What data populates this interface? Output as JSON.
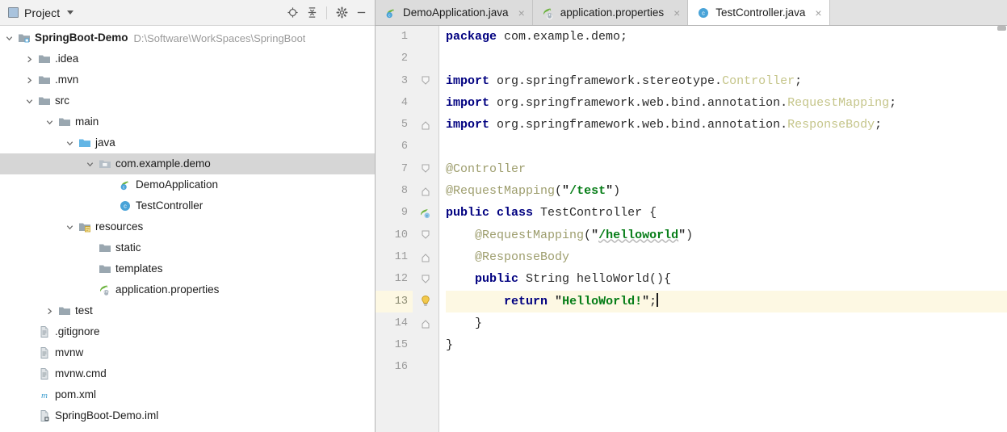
{
  "toolwindow": {
    "title": "Project",
    "dropdown_icon": "chevron-down-icon",
    "panel_icon": "project-view-icon",
    "actions": [
      {
        "name": "locate-icon",
        "label": "Select Opened File"
      },
      {
        "name": "collapse-all-icon",
        "label": "Collapse All"
      },
      {
        "name": "gear-icon",
        "label": "Settings"
      },
      {
        "name": "minimize-icon",
        "label": "Hide"
      }
    ]
  },
  "tree": [
    {
      "label": "SpringBoot-Demo",
      "path": "D:\\Software\\WorkSpaces\\SpringBoot",
      "indent": 0,
      "arrow": "expanded",
      "icon": "module-folder-icon",
      "bold": true,
      "selected": false
    },
    {
      "label": ".idea",
      "path": "",
      "indent": 1,
      "arrow": "collapsed",
      "icon": "folder-icon",
      "bold": false,
      "selected": false
    },
    {
      "label": ".mvn",
      "path": "",
      "indent": 1,
      "arrow": "collapsed",
      "icon": "folder-icon",
      "bold": false,
      "selected": false
    },
    {
      "label": "src",
      "path": "",
      "indent": 1,
      "arrow": "expanded",
      "icon": "folder-icon",
      "bold": false,
      "selected": false
    },
    {
      "label": "main",
      "path": "",
      "indent": 2,
      "arrow": "expanded",
      "icon": "folder-icon",
      "bold": false,
      "selected": false
    },
    {
      "label": "java",
      "path": "",
      "indent": 3,
      "arrow": "expanded",
      "icon": "source-folder-icon",
      "bold": false,
      "selected": false
    },
    {
      "label": "com.example.demo",
      "path": "",
      "indent": 4,
      "arrow": "expanded",
      "icon": "package-icon",
      "bold": false,
      "selected": true
    },
    {
      "label": "DemoApplication",
      "path": "",
      "indent": 5,
      "arrow": "none",
      "icon": "spring-boot-class-icon",
      "bold": false,
      "selected": false
    },
    {
      "label": "TestController",
      "path": "",
      "indent": 5,
      "arrow": "none",
      "icon": "java-class-icon",
      "bold": false,
      "selected": false
    },
    {
      "label": "resources",
      "path": "",
      "indent": 3,
      "arrow": "expanded",
      "icon": "resource-folder-icon",
      "bold": false,
      "selected": false
    },
    {
      "label": "static",
      "path": "",
      "indent": 4,
      "arrow": "none",
      "icon": "folder-icon",
      "bold": false,
      "selected": false
    },
    {
      "label": "templates",
      "path": "",
      "indent": 4,
      "arrow": "none",
      "icon": "folder-icon",
      "bold": false,
      "selected": false
    },
    {
      "label": "application.properties",
      "path": "",
      "indent": 4,
      "arrow": "none",
      "icon": "spring-properties-icon",
      "bold": false,
      "selected": false
    },
    {
      "label": "test",
      "path": "",
      "indent": 2,
      "arrow": "collapsed",
      "icon": "folder-icon",
      "bold": false,
      "selected": false
    },
    {
      "label": ".gitignore",
      "path": "",
      "indent": 1,
      "arrow": "none",
      "icon": "text-file-icon",
      "bold": false,
      "selected": false
    },
    {
      "label": "mvnw",
      "path": "",
      "indent": 1,
      "arrow": "none",
      "icon": "text-file-icon",
      "bold": false,
      "selected": false
    },
    {
      "label": "mvnw.cmd",
      "path": "",
      "indent": 1,
      "arrow": "none",
      "icon": "text-file-icon",
      "bold": false,
      "selected": false
    },
    {
      "label": "pom.xml",
      "path": "",
      "indent": 1,
      "arrow": "none",
      "icon": "maven-icon",
      "bold": false,
      "selected": false
    },
    {
      "label": "SpringBoot-Demo.iml",
      "path": "",
      "indent": 1,
      "arrow": "none",
      "icon": "iml-file-icon",
      "bold": false,
      "selected": false
    }
  ],
  "tabs": [
    {
      "label": "DemoApplication.java",
      "icon": "spring-boot-class-icon",
      "active": false,
      "close": "×"
    },
    {
      "label": "application.properties",
      "icon": "spring-properties-icon",
      "active": false,
      "close": "×"
    },
    {
      "label": "TestController.java",
      "icon": "java-class-icon",
      "active": true,
      "close": "×"
    }
  ],
  "editor": {
    "highlight_line": 13,
    "line_numbers": [
      "1",
      "2",
      "3",
      "4",
      "5",
      "6",
      "7",
      "8",
      "9",
      "10",
      "11",
      "12",
      "13",
      "14",
      "15",
      "16"
    ],
    "gutter_markers": [
      {
        "line": 3,
        "type": "fold-start-icon"
      },
      {
        "line": 5,
        "type": "fold-end-icon"
      },
      {
        "line": 7,
        "type": "fold-start-icon"
      },
      {
        "line": 8,
        "type": "fold-end-icon"
      },
      {
        "line": 9,
        "type": "spring-bean-icon"
      },
      {
        "line": 10,
        "type": "fold-start-icon"
      },
      {
        "line": 11,
        "type": "fold-end-icon"
      },
      {
        "line": 12,
        "type": "fold-start-icon"
      },
      {
        "line": 13,
        "type": "intention-bulb-icon"
      },
      {
        "line": 14,
        "type": "fold-end-icon"
      }
    ],
    "lines": [
      {
        "n": 1,
        "text": "package com.example.demo;"
      },
      {
        "n": 2,
        "text": ""
      },
      {
        "n": 3,
        "text": "import org.springframework.stereotype.Controller;"
      },
      {
        "n": 4,
        "text": "import org.springframework.web.bind.annotation.RequestMapping;"
      },
      {
        "n": 5,
        "text": "import org.springframework.web.bind.annotation.ResponseBody;"
      },
      {
        "n": 6,
        "text": ""
      },
      {
        "n": 7,
        "text": "@Controller"
      },
      {
        "n": 8,
        "text": "@RequestMapping(\"/test\")"
      },
      {
        "n": 9,
        "text": "public class TestController {"
      },
      {
        "n": 10,
        "text": "    @RequestMapping(\"/helloworld\")"
      },
      {
        "n": 11,
        "text": "    @ResponseBody"
      },
      {
        "n": 12,
        "text": "    public String helloWorld(){"
      },
      {
        "n": 13,
        "text": "        return \"HelloWorld!\";"
      },
      {
        "n": 14,
        "text": "    }"
      },
      {
        "n": 15,
        "text": "}"
      },
      {
        "n": 16,
        "text": ""
      }
    ],
    "tokens": {
      "kw_package": "package",
      "kw_import": "import",
      "kw_public": "public",
      "kw_class": "class",
      "kw_return": "return",
      "pkg_name": " com.example.demo;",
      "imp1_pkg": " org.springframework.stereotype.",
      "imp1_cls": "Controller",
      "imp2_pkg": " org.springframework.web.bind.annotation.",
      "imp2_cls": "RequestMapping",
      "imp3_pkg": " org.springframework.web.bind.annotation.",
      "imp3_cls": "ResponseBody",
      "semi": ";",
      "anno_controller": "@Controller",
      "anno_requestmapping": "@RequestMapping",
      "anno_responsebody": "@ResponseBody",
      "paren_open": "(",
      "paren_close": ")",
      "quote": "\"",
      "str_test": "/test",
      "str_helloworld": "/helloworld",
      "str_hello": "HelloWorld!",
      "class_name": " TestController {",
      "method_sig": " String helloWorld(){",
      "brace_close_inner": "    }",
      "brace_close_outer": "}",
      "indent4": "    ",
      "indent8": "        ",
      "stmt_end": ";"
    }
  },
  "colors": {
    "keyword": "#000080",
    "string": "#067d17",
    "annotation": "#9e9e6e",
    "class_ref": "#c5c58a",
    "line_highlight": "#fdf8e3",
    "selection": "#d6d6d6",
    "gutter_bg": "#f0f0f0",
    "tabbar_bg": "#e2e2e2",
    "panel_bg": "#f2f2f2"
  }
}
